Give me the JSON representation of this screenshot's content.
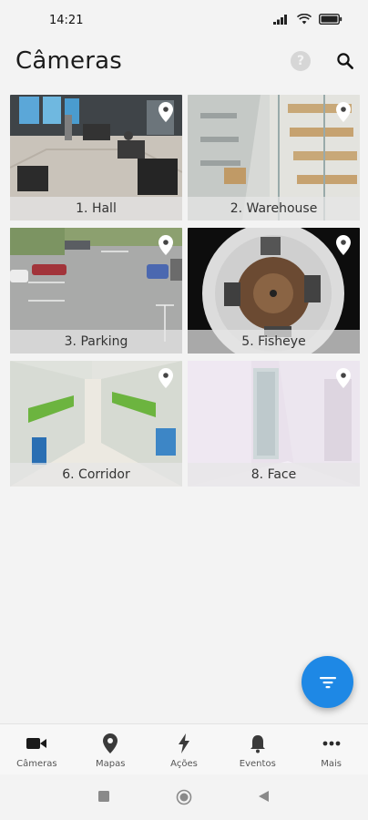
{
  "status_bar": {
    "time": "14:21"
  },
  "header": {
    "title": "Câmeras",
    "help_icon": "help-circle-icon",
    "search_icon": "search-icon"
  },
  "cameras": [
    {
      "label": "1. Hall",
      "scene": "lobby"
    },
    {
      "label": "2. Warehouse",
      "scene": "warehouse"
    },
    {
      "label": "3. Parking",
      "scene": "parking"
    },
    {
      "label": "5. Fisheye",
      "scene": "fisheye"
    },
    {
      "label": "6. Corridor",
      "scene": "corridor"
    },
    {
      "label": "8. Face",
      "scene": "face"
    }
  ],
  "fab": {
    "icon": "filter-icon"
  },
  "bottom_nav": [
    {
      "label": "Câmeras",
      "icon": "video-camera-icon",
      "active": true
    },
    {
      "label": "Mapas",
      "icon": "map-pin-icon"
    },
    {
      "label": "Ações",
      "icon": "bolt-icon"
    },
    {
      "label": "Eventos",
      "icon": "bell-icon"
    },
    {
      "label": "Mais",
      "icon": "more-icon"
    }
  ],
  "colors": {
    "accent": "#1e88e5",
    "background": "#f3f3f3"
  }
}
